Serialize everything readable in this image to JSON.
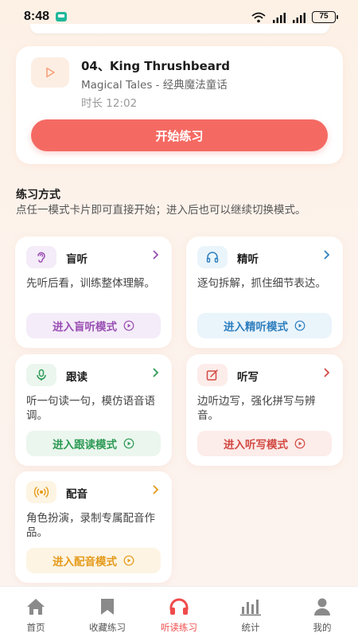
{
  "status_bar": {
    "time": "8:48",
    "battery": "75"
  },
  "track": {
    "title": "04、King Thrushbeard",
    "subtitle": "Magical Tales - 经典魔法童话",
    "duration": "时长 12:02",
    "start_label": "开始练习"
  },
  "section": {
    "title": "练习方式",
    "desc": "点任一模式卡片即可直接开始；进入后也可以继续切换模式。"
  },
  "modes": [
    {
      "name": "盲听",
      "desc": "先听后看，训练整体理解。",
      "button": "进入盲听模式",
      "icon": "ear-icon",
      "color": "#9a4fb3",
      "bg": "#f4ecf8"
    },
    {
      "name": "精听",
      "desc": "逐句拆解，抓住细节表达。",
      "button": "进入精听模式",
      "icon": "headphones-icon",
      "color": "#2f7fbf",
      "bg": "#eaf4fb"
    },
    {
      "name": "跟读",
      "desc": "听一句读一句，模仿语音语调。",
      "button": "进入跟读模式",
      "icon": "microphone-icon",
      "color": "#2d9a55",
      "bg": "#ebf6ee"
    },
    {
      "name": "听写",
      "desc": "边听边写，强化拼写与辨音。",
      "button": "进入听写模式",
      "icon": "edit-icon",
      "color": "#d24a43",
      "bg": "#fcecea"
    },
    {
      "name": "配音",
      "desc": "角色扮演，录制专属配音作品。",
      "button": "进入配音模式",
      "icon": "broadcast-icon",
      "color": "#e59a1b",
      "bg": "#fdf4e3"
    }
  ],
  "nav": [
    {
      "label": "首页",
      "icon": "home-icon"
    },
    {
      "label": "收藏练习",
      "icon": "bookmark-icon"
    },
    {
      "label": "听读练习",
      "icon": "headphones-icon"
    },
    {
      "label": "统计",
      "icon": "bar-chart-icon"
    },
    {
      "label": "我的",
      "icon": "user-icon"
    }
  ],
  "colors": {
    "accent": "#f46a63",
    "nav_active": "#ef4b4b",
    "nav_inactive": "#8a8a8a"
  }
}
